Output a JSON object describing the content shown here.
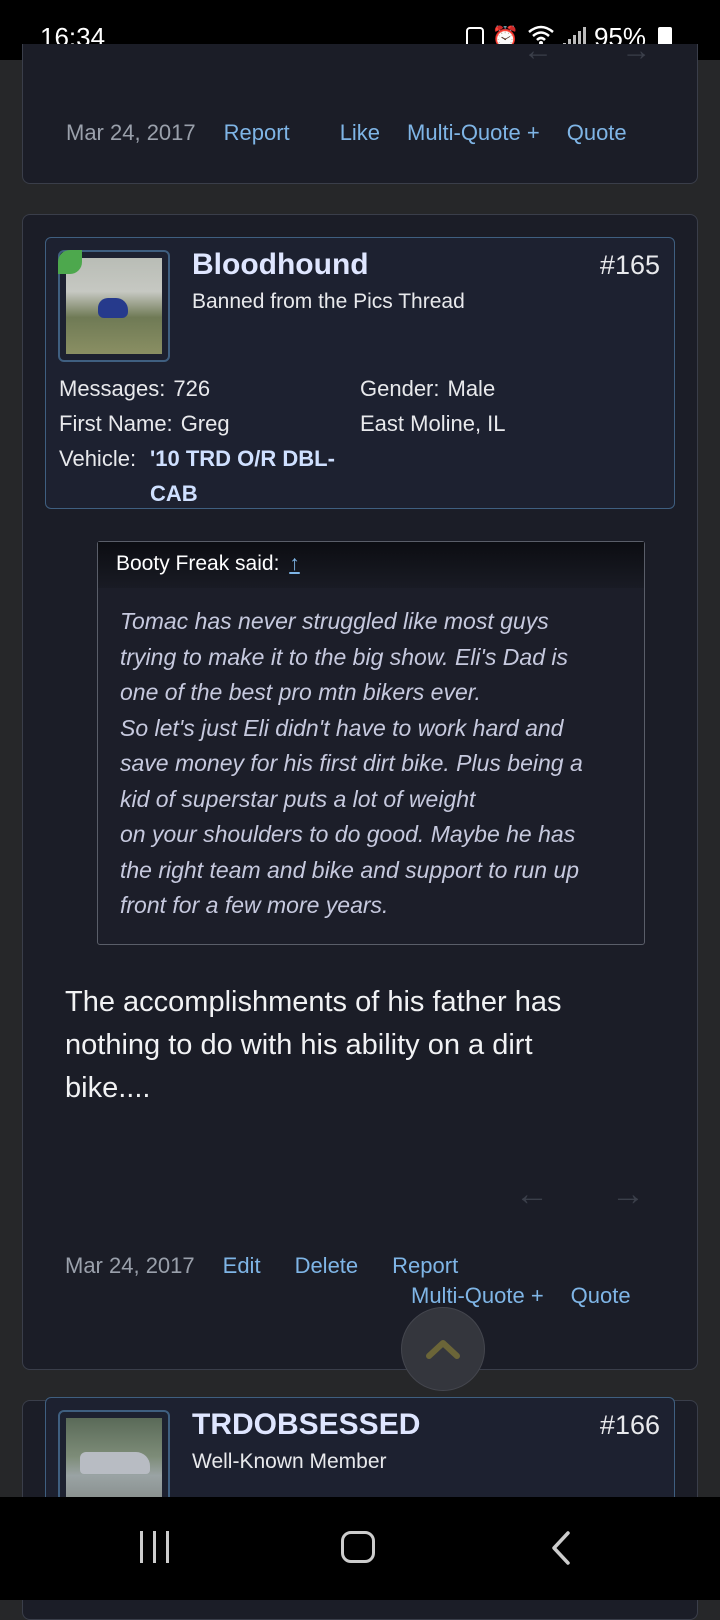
{
  "status_bar": {
    "time": "16:34",
    "battery": "95%",
    "icons": [
      "data-saver-icon",
      "alarm-icon",
      "wifi-icon",
      "signal-icon",
      "battery-icon"
    ]
  },
  "prev_post": {
    "date": "Mar 24, 2017",
    "actions": {
      "report": "Report",
      "like": "Like",
      "multiquote": "Multi-Quote +",
      "quote": "Quote"
    }
  },
  "post": {
    "username": "Bloodhound",
    "user_title": "Banned from the Pics Thread",
    "number": "#165",
    "stats": {
      "messages_label": "Messages:",
      "messages_value": "726",
      "gender_label": "Gender:",
      "gender_value": "Male",
      "firstname_label": "First Name:",
      "firstname_value": "Greg",
      "location": "East Moline, IL",
      "vehicle_label": "Vehicle:",
      "vehicle_value_1": "'10 TRD O/R DBL-",
      "vehicle_value_2": "CAB"
    },
    "quote": {
      "attribution": "Booty Freak said:",
      "jump": "↑",
      "lines": [
        "Tomac has never struggled like most guys",
        "trying to make it to the big show. Eli's Dad is",
        "one of the best pro mtn bikers ever.",
        "So let's just Eli didn't have to work hard and",
        "save money for his first dirt bike. Plus being a",
        "kid of superstar puts a lot of weight",
        "on your shoulders to do good. Maybe he has",
        "the right team and bike and support to run up",
        "front for a few more years."
      ]
    },
    "body_lines": [
      "The accomplishments of his father has",
      "nothing to do with his ability on a dirt",
      "bike...."
    ],
    "date": "Mar 24, 2017",
    "actions": {
      "edit": "Edit",
      "delete": "Delete",
      "report": "Report",
      "multiquote": "Multi-Quote +",
      "quote": "Quote"
    }
  },
  "next_post": {
    "username": "TRDOBSESSED",
    "user_title": "Well-Known Member",
    "number": "#166"
  }
}
